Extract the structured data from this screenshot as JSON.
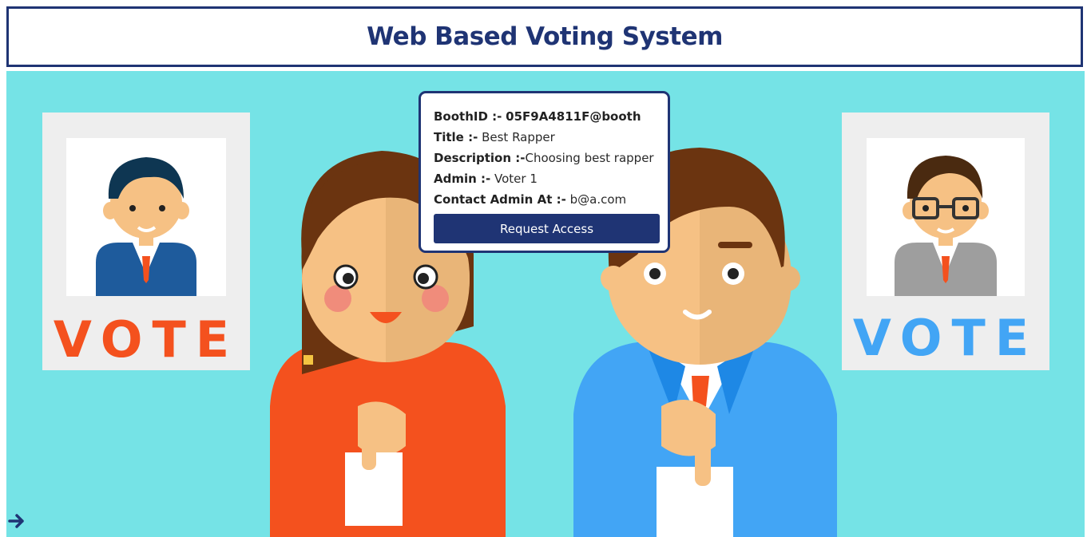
{
  "header": {
    "title": "Web Based Voting System"
  },
  "booth": {
    "boothid_label": "BoothID :-",
    "boothid_value": "05F9A4811F@booth",
    "title_label": "Title :-",
    "title_value": "Best Rapper",
    "description_label": "Description :-",
    "description_value": "Choosing best rapper",
    "admin_label": "Admin :-",
    "admin_value": "Voter 1",
    "contact_label": "Contact Admin At :-",
    "contact_value": "b@a.com",
    "request_label": "Request Access"
  },
  "posters": {
    "left_text": "VOTE",
    "right_text": "VOTE"
  },
  "colors": {
    "brand": "#1f3474",
    "hero_bg": "#75e3e6",
    "vote_left": "#f4511e",
    "vote_right": "#42a5f5"
  },
  "icons": {
    "nav_arrow": "arrow-right-icon"
  }
}
